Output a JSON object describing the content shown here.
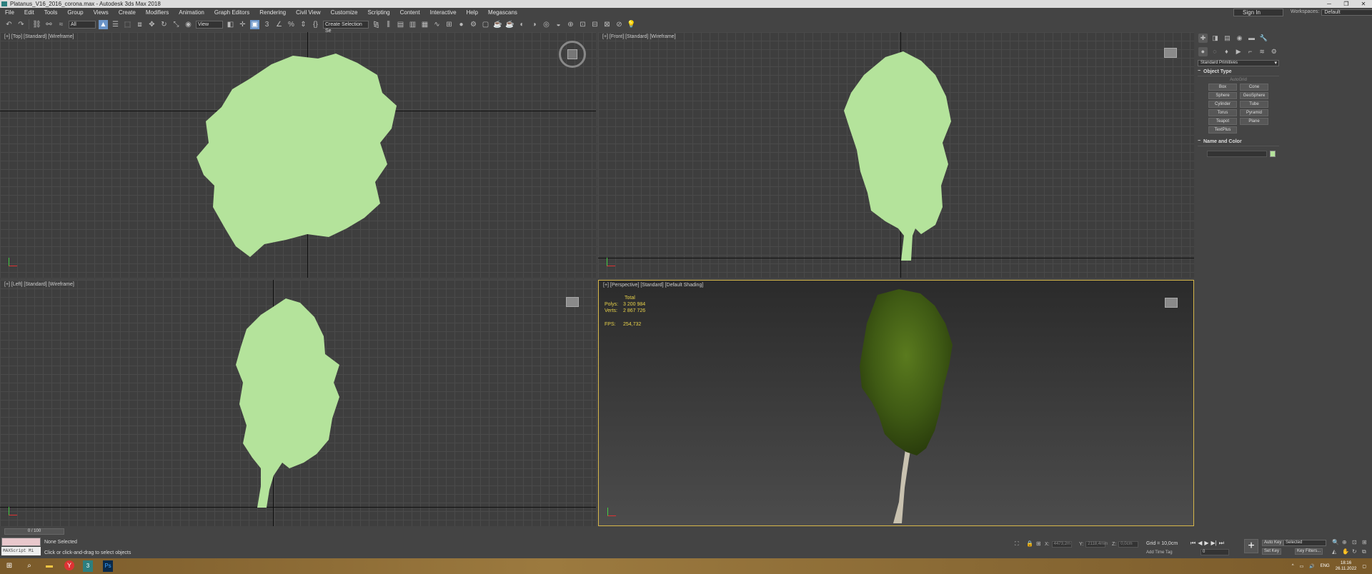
{
  "window": {
    "title": "Platanus_V16_2016_corona.max - Autodesk 3ds Max 2018",
    "min": "─",
    "max": "❐",
    "close": "✕"
  },
  "menu": [
    "File",
    "Edit",
    "Tools",
    "Group",
    "Views",
    "Create",
    "Modifiers",
    "Animation",
    "Graph Editors",
    "Rendering",
    "Civil View",
    "Customize",
    "Scripting",
    "Content",
    "Interactive",
    "Help",
    "Megascans"
  ],
  "signin": "Sign In",
  "workspaces": {
    "label": "Workspaces:",
    "value": "Default"
  },
  "toolbar": {
    "filter": "All",
    "refcoord": "View",
    "selset": "Create Selection Se"
  },
  "viewports": {
    "top": "[+] [Top] [Standard] [Wireframe]",
    "front": "[+] [Front] [Standard] [Wireframe]",
    "left": "[+] [Left] [Standard] [Wireframe]",
    "persp": "[+] [Perspective] [Standard] [Default Shading]"
  },
  "stats": {
    "total": "Total",
    "polys_label": "Polys:",
    "polys": "3 200 984",
    "verts_label": "Verts:",
    "verts": "2 867 726",
    "fps_label": "FPS:",
    "fps": "254,732"
  },
  "cmdpanel": {
    "category": "Standard Primitives",
    "object_type": "Object Type",
    "autogrid": "AutoGrid",
    "objects": [
      "Box",
      "Cone",
      "Sphere",
      "GeoSphere",
      "Cylinder",
      "Tube",
      "Torus",
      "Pyramid",
      "Teapot",
      "Plane",
      "TextPlus"
    ],
    "name_color": "Name and Color"
  },
  "colors": {
    "tree": "#b4e39b",
    "selected_border": "#d6b64a",
    "taskbar": "#8a6a35"
  },
  "timeline": {
    "frame": "0 / 100"
  },
  "status": {
    "maxscript": "MAXScript Mi",
    "selection": "None Selected",
    "prompt": "Click or click-and-drag to select objects",
    "x_label": "X:",
    "x": "4473,2m",
    "y_label": "Y:",
    "y": "2118,4mm",
    "z_label": "Z:",
    "z": "0,0cm",
    "grid": "Grid = 10,0cm",
    "addtimetag": "Add Time Tag",
    "autokey": "Auto Key",
    "selected": "Selected",
    "setkey": "Set Key",
    "keyfilters": "Key Filters...",
    "frame": "0"
  },
  "taskbar": {
    "lang": "ENG",
    "time": "18:16",
    "date": "26.11.2022"
  }
}
